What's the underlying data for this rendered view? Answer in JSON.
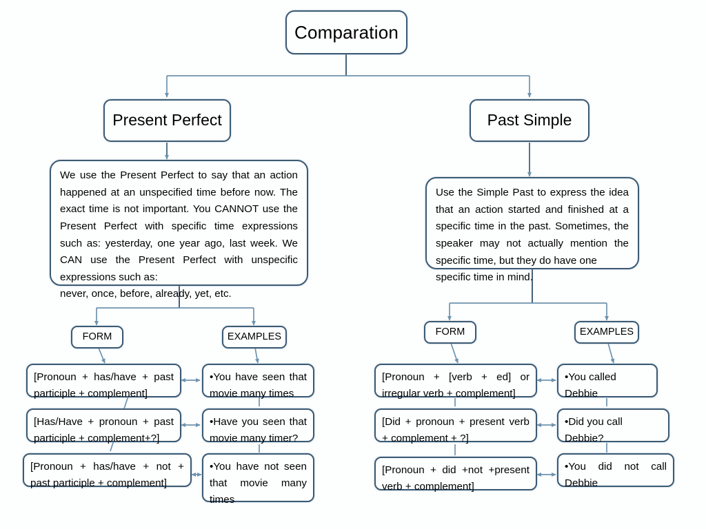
{
  "diagram": {
    "title": "Comparation",
    "theme": {
      "border_color": "#3b5a73",
      "connector_color": "#6e93ae",
      "background": "#fdfefe",
      "text_color": "#000000"
    },
    "branches": {
      "present_perfect": {
        "heading": "Present Perfect",
        "description": "We use the Present Perfect to say that an action happened at an unspecified time before now. The exact time is not important. You CANNOT use the Present Perfect with specific time expressions such as: yesterday, one year ago, last week. We CAN use the Present Perfect with unspecific expressions such as:",
        "description_last_line": "never, once, before, already, yet, etc.",
        "form_label": "FORM",
        "examples_label": "EXAMPLES",
        "forms": [
          "[Pronoun + has/have + past participle + complement]",
          "[Has/Have + pronoun + past participle + complement+?]",
          "[Pronoun + has/have + not + past participle + complement]"
        ],
        "examples": [
          "•You have seen that movie many times",
          "•Have you seen that movie many timer?",
          "•You have not seen that movie many times"
        ]
      },
      "past_simple": {
        "heading": "Past Simple",
        "description": "Use the Simple Past to express the idea that an action started and finished at a specific time in the past. Sometimes, the speaker may not actually mention the specific time, but they do have one",
        "description_last_line": "specific time in mind.",
        "form_label": "FORM",
        "examples_label": "EXAMPLES",
        "forms": [
          "[Pronoun + [verb + ed] or irregular verb + complement]",
          "[Did + pronoun + present verb + complement + ?]",
          "[Pronoun + did +not +present verb + complement]"
        ],
        "examples": [
          "•You called Debbie",
          "•Did you call Debbie?",
          "•You did not call Debbie"
        ]
      }
    }
  }
}
